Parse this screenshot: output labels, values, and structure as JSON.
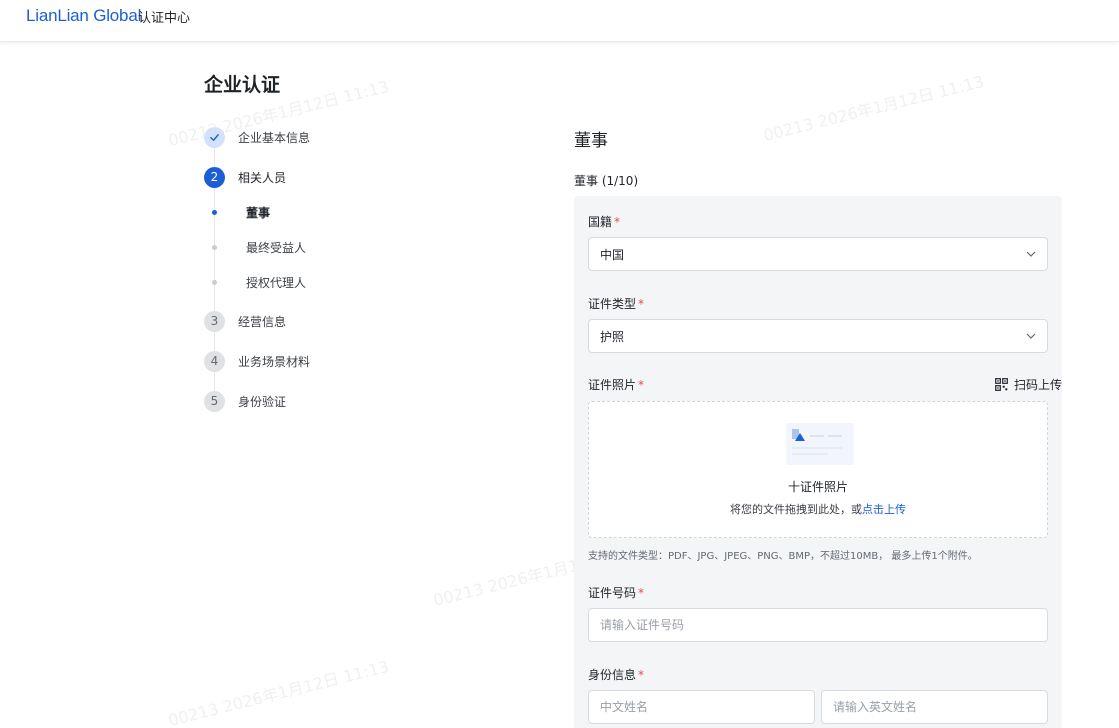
{
  "header": {
    "logo_text": "LianLian Global",
    "title": "认证中心"
  },
  "page": {
    "title": "企业认证"
  },
  "steps": [
    {
      "number": "✓",
      "label": "企业基本信息",
      "state": "done"
    },
    {
      "number": "2",
      "label": "相关人员",
      "state": "active"
    },
    {
      "number": "3",
      "label": "经营信息",
      "state": "todo"
    },
    {
      "number": "4",
      "label": "业务场景材料",
      "state": "todo"
    },
    {
      "number": "5",
      "label": "身份验证",
      "state": "todo"
    }
  ],
  "substeps": [
    {
      "label": "董事",
      "active": true
    },
    {
      "label": "最终受益人",
      "active": false
    },
    {
      "label": "授权代理人",
      "active": false
    }
  ],
  "form": {
    "section_title": "董事",
    "section_subtitle": "董事 (1/10)",
    "required_mark": "*",
    "nationality": {
      "label": "国籍",
      "value": "中国"
    },
    "id_type": {
      "label": "证件类型",
      "value": "护照"
    },
    "id_photo": {
      "label": "证件照片",
      "scan_upload": "扫码上传",
      "upload_title": "十证件照片",
      "upload_hint": "将您的文件拖拽到此处，或",
      "upload_link": "点击上传",
      "note": "支持的文件类型：PDF、JPG、JPEG、PNG、BMP，不超过10MB， 最多上传1个附件。"
    },
    "id_number": {
      "label": "证件号码",
      "placeholder": "请输入证件号码"
    },
    "identity": {
      "label": "身份信息",
      "cn_name_placeholder": "中文姓名",
      "en_name_placeholder": "请输入英文姓名"
    }
  },
  "colors": {
    "primary": "#1a5fd6",
    "required": "#e34d59",
    "panel_bg": "#f4f5f7"
  },
  "watermark": {
    "text": "00213 2026年1月12日 11:13"
  }
}
